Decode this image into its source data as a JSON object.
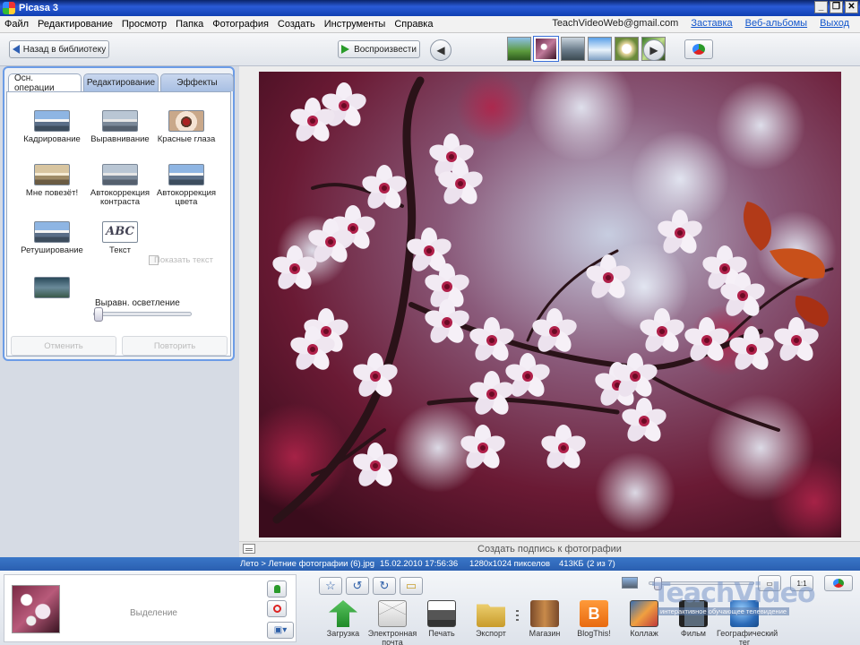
{
  "window": {
    "title": "Picasa 3",
    "buttons": [
      "_",
      "❐",
      "✕"
    ]
  },
  "menu": {
    "items": [
      "Файл",
      "Редактирование",
      "Просмотр",
      "Папка",
      "Фотография",
      "Создать",
      "Инструменты",
      "Справка"
    ],
    "account": "TeachVideoWeb@gmail.com",
    "links": [
      "Заставка",
      "Веб-альбомы",
      "Выход"
    ]
  },
  "toolbar": {
    "back_label": "Назад в библиотеку",
    "play_label": "Воспроизвести"
  },
  "tabs": [
    "Осн. операции",
    "Редактирование",
    "Эффекты"
  ],
  "tools": {
    "crop": "Кадрирование",
    "straighten": "Выравнивание",
    "redeye": "Красные глаза",
    "lucky": "Мне повезёт!",
    "auto_contrast": "Автокоррекция контраста",
    "auto_color": "Автокоррекция цвета",
    "retouch": "Ретуширование",
    "text": "Текст",
    "abc": "ABC",
    "show_text": "Показать текст",
    "fill_light": "Выравн. осветление",
    "undo": "Отменить",
    "redo": "Повторить"
  },
  "fill_light_level": 0.0,
  "caption_placeholder": "Создать подпись к фотографии",
  "status": {
    "path": "Лето > Летние фотографии (6).jpg",
    "datetime": "15.02.2010 17:56:36",
    "dimensions": "1280x1024 пикселов",
    "size": "413КБ",
    "index": "(2 из 7)"
  },
  "tray": {
    "selection_label": "Выделение"
  },
  "actions": [
    "Загрузка",
    "Электронная почта",
    "Печать",
    "Экспорт",
    "Магазин",
    "BlogThis!",
    "Коллаж",
    "Фильм",
    "Географический тег"
  ],
  "zoom_level": 0.05,
  "watermark": {
    "title": "TeachVideo",
    "subtitle": "интерактивное обучающее телевидение"
  },
  "colors": {
    "accent": "#2a5fb0",
    "panel_border": "#6c9ce6",
    "link": "#1155cc"
  }
}
